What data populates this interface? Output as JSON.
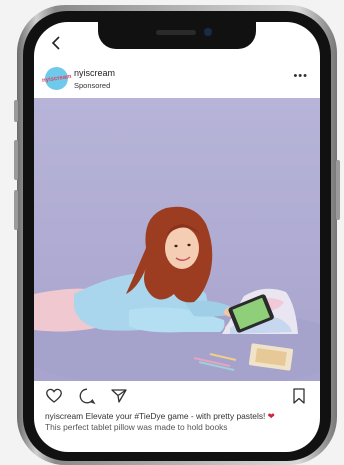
{
  "post": {
    "username": "nyiscream",
    "sponsored": "Sponsored",
    "avatar_text": "nyiscream",
    "more": "•••"
  },
  "caption": {
    "user": "nyiscream",
    "text": " Elevate your #TieDye game - with pretty pastels! ",
    "heart": "❤",
    "line2": "This perfect tablet pillow was made to hold books"
  },
  "icons": [
    "back-icon",
    "more-icon",
    "heart-icon",
    "comment-icon",
    "share-icon",
    "bookmark-icon"
  ],
  "colors": {
    "photo_background": "#b4b1d6",
    "sweater": "#a9d6ec",
    "hair": "#9c3d22",
    "heart": "#d4213d"
  }
}
